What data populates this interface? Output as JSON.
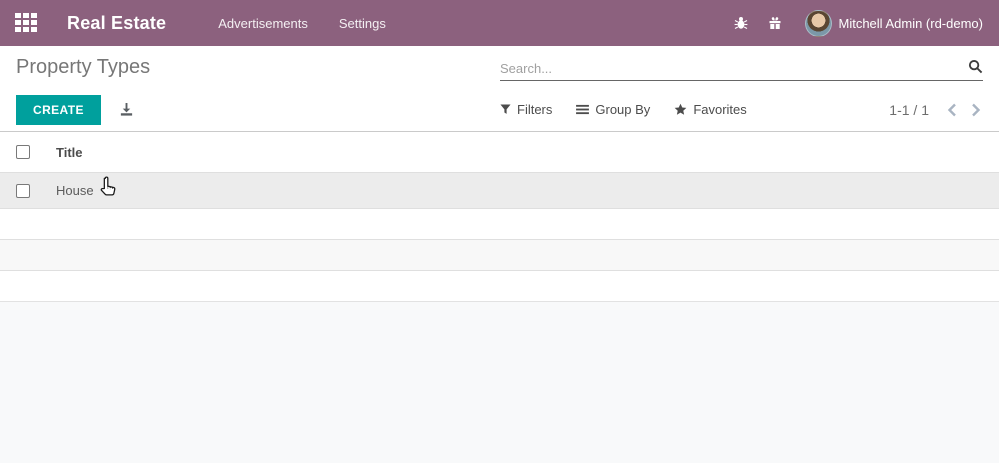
{
  "navbar": {
    "app_name": "Real Estate",
    "menu_items": [
      {
        "label": "Advertisements"
      },
      {
        "label": "Settings"
      }
    ],
    "user_name": "Mitchell Admin (rd-demo)"
  },
  "breadcrumb": {
    "title": "Property Types"
  },
  "search": {
    "placeholder": "Search...",
    "value": ""
  },
  "toolbar": {
    "create_label": "CREATE",
    "filters_label": "Filters",
    "group_by_label": "Group By",
    "favorites_label": "Favorites"
  },
  "pager": {
    "value": "1-1 / 1",
    "range": "1-1",
    "total": "1"
  },
  "table": {
    "columns": [
      {
        "label": "Title"
      }
    ],
    "rows": [
      {
        "title": "House",
        "checked": false
      }
    ]
  },
  "icons": {
    "apps_menu": "grid-3x3",
    "debug": "bug",
    "promotion": "gift",
    "search": "magnifier",
    "export": "download-arrow",
    "filters": "funnel",
    "group_by": "three-lines",
    "favorites": "star",
    "pager_prev": "chevron-left",
    "pager_next": "chevron-right"
  },
  "colors": {
    "navbar_bg": "#8c617e",
    "primary": "#00a09d",
    "row_hover_bg": "#ececec",
    "stripe_bg": "#f8f8f8",
    "content_bg": "#f8f9fa"
  }
}
